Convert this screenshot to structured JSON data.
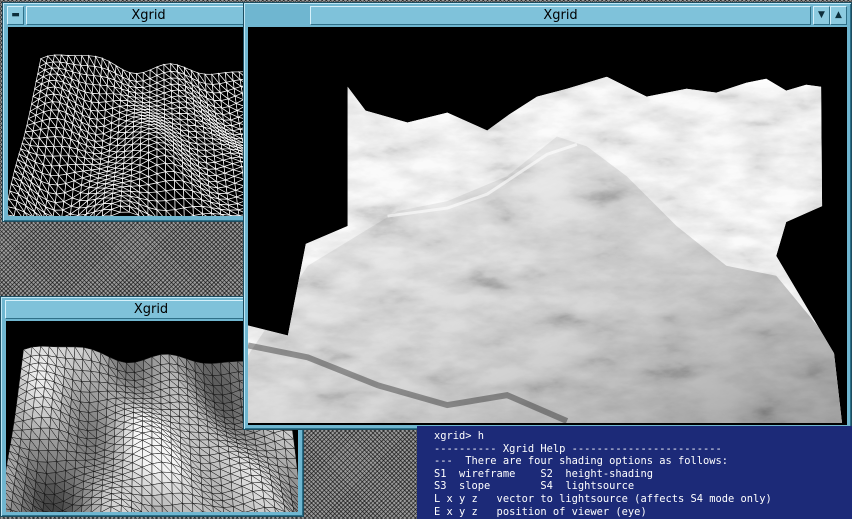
{
  "windows": [
    {
      "title": "Xgrid",
      "view": "wireframe"
    },
    {
      "title": "Xgrid",
      "view": "lightsource"
    },
    {
      "title": "Xgrid",
      "view": "height-shading"
    }
  ],
  "titlebar_buttons": {
    "menu": "▼",
    "maximize": "▲"
  },
  "terminal": {
    "lines": [
      "xgrid> h",
      "---------- Xgrid Help ------------------------",
      "---  There are four shading options as follows:",
      "S1  wireframe    S2  height-shading",
      "S3  slope        S4  lightsource",
      "L x y z   vector to lightsource (affects S4 mode only)",
      "E x y z   position of viewer (eye)"
    ]
  },
  "colors": {
    "window_frame": "#6fb6d0",
    "terminal_bg": "#1c2a78",
    "terminal_fg": "#ffffff"
  }
}
